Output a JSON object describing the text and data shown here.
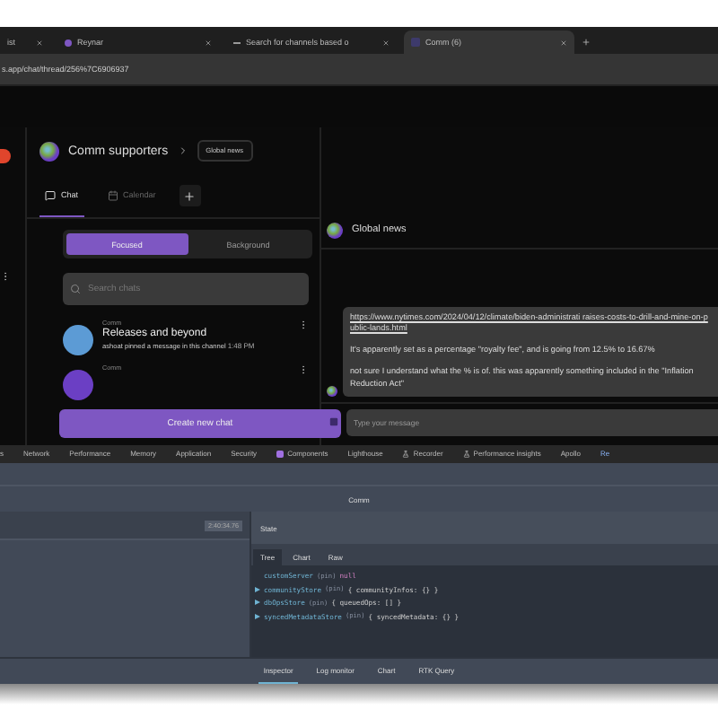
{
  "browser": {
    "tabs": [
      {
        "title": "ist",
        "selected": false,
        "kind": "none"
      },
      {
        "title": "Reynar",
        "selected": false,
        "kind": "dot"
      },
      {
        "title": "Search for channels based o",
        "selected": false,
        "kind": "dash"
      },
      {
        "title": "Comm (6)",
        "selected": true,
        "kind": "logo"
      }
    ],
    "url": "s.app/chat/thread/256%7C6906937"
  },
  "app": {
    "community": "Comm supporters",
    "thread_button": "Global news",
    "nav_tabs": [
      {
        "label": "Chat",
        "selected": true,
        "kind": "chat"
      },
      {
        "label": "Calendar",
        "selected": false,
        "kind": "calendar"
      }
    ],
    "filters": [
      {
        "label": "Focused",
        "selected": true
      },
      {
        "label": "Background",
        "selected": false
      }
    ],
    "search": {
      "placeholder": "Search chats"
    },
    "chats": [
      {
        "community": "Comm",
        "title": "Releases and beyond",
        "preview": "ashoat pinned a message in this channel",
        "time": "1:48 PM"
      },
      {
        "community": "Comm"
      }
    ],
    "create_button": "Create new chat",
    "thread": {
      "title": "Global news",
      "message": [
        {
          "kind": "link",
          "text": "https://www.nytimes.com/2024/04/12/climate/biden-administrati raises-costs-to-drill-and-mine-on-public-lands.html"
        },
        {
          "kind": "text",
          "text": "It's apparently set as a percentage \"royalty fee\", and is going from 12.5% to 16.67%"
        },
        {
          "kind": "text",
          "text": "not sure I understand what the % is of. this was apparently something included in the \"Inflation Reduction Act\""
        }
      ],
      "composer": {
        "placeholder": "Type your message"
      }
    }
  },
  "devtools": {
    "tabs": [
      {
        "label": "s",
        "selected": false,
        "kind": "plain"
      },
      {
        "label": "Network",
        "selected": false,
        "kind": "plain"
      },
      {
        "label": "Performance",
        "selected": false,
        "kind": "plain"
      },
      {
        "label": "Memory",
        "selected": false,
        "kind": "plain"
      },
      {
        "label": "Application",
        "selected": false,
        "kind": "plain"
      },
      {
        "label": "Security",
        "selected": false,
        "kind": "plain"
      },
      {
        "label": "Components",
        "selected": false,
        "kind": "react"
      },
      {
        "label": "Lighthouse",
        "selected": false,
        "kind": "plain"
      },
      {
        "label": "Recorder",
        "selected": false,
        "kind": "flask"
      },
      {
        "label": "Performance insights",
        "selected": false,
        "kind": "flask"
      },
      {
        "label": "Apollo",
        "selected": false,
        "kind": "plain"
      },
      {
        "label": "Re",
        "selected": true,
        "kind": "plain"
      }
    ],
    "title": "Comm",
    "timestamp": "2:40:34.76",
    "state_title": "State",
    "state_tabs": [
      {
        "label": "Tree",
        "selected": true
      },
      {
        "label": "Chart",
        "selected": false
      },
      {
        "label": "Raw",
        "selected": false
      }
    ],
    "tree": [
      {
        "key": "customServer",
        "tag": "(pin)",
        "value": "null",
        "expandable": false
      },
      {
        "key": "communityStore",
        "tag": "(pin)",
        "value": "{ communityInfos: {} }",
        "expandable": true
      },
      {
        "key": "dbOpsStore",
        "tag": "(pin)",
        "value": "{ queuedOps: [] }",
        "expandable": true
      },
      {
        "key": "syncedMetadataStore",
        "tag": "(pin)",
        "value": "{ syncedMetadata: {} }",
        "expandable": true
      }
    ],
    "bottom_tabs": [
      {
        "label": "Inspector",
        "selected": true
      },
      {
        "label": "Log monitor",
        "selected": false
      },
      {
        "label": "Chart",
        "selected": false
      },
      {
        "label": "RTK Query",
        "selected": false
      }
    ]
  }
}
